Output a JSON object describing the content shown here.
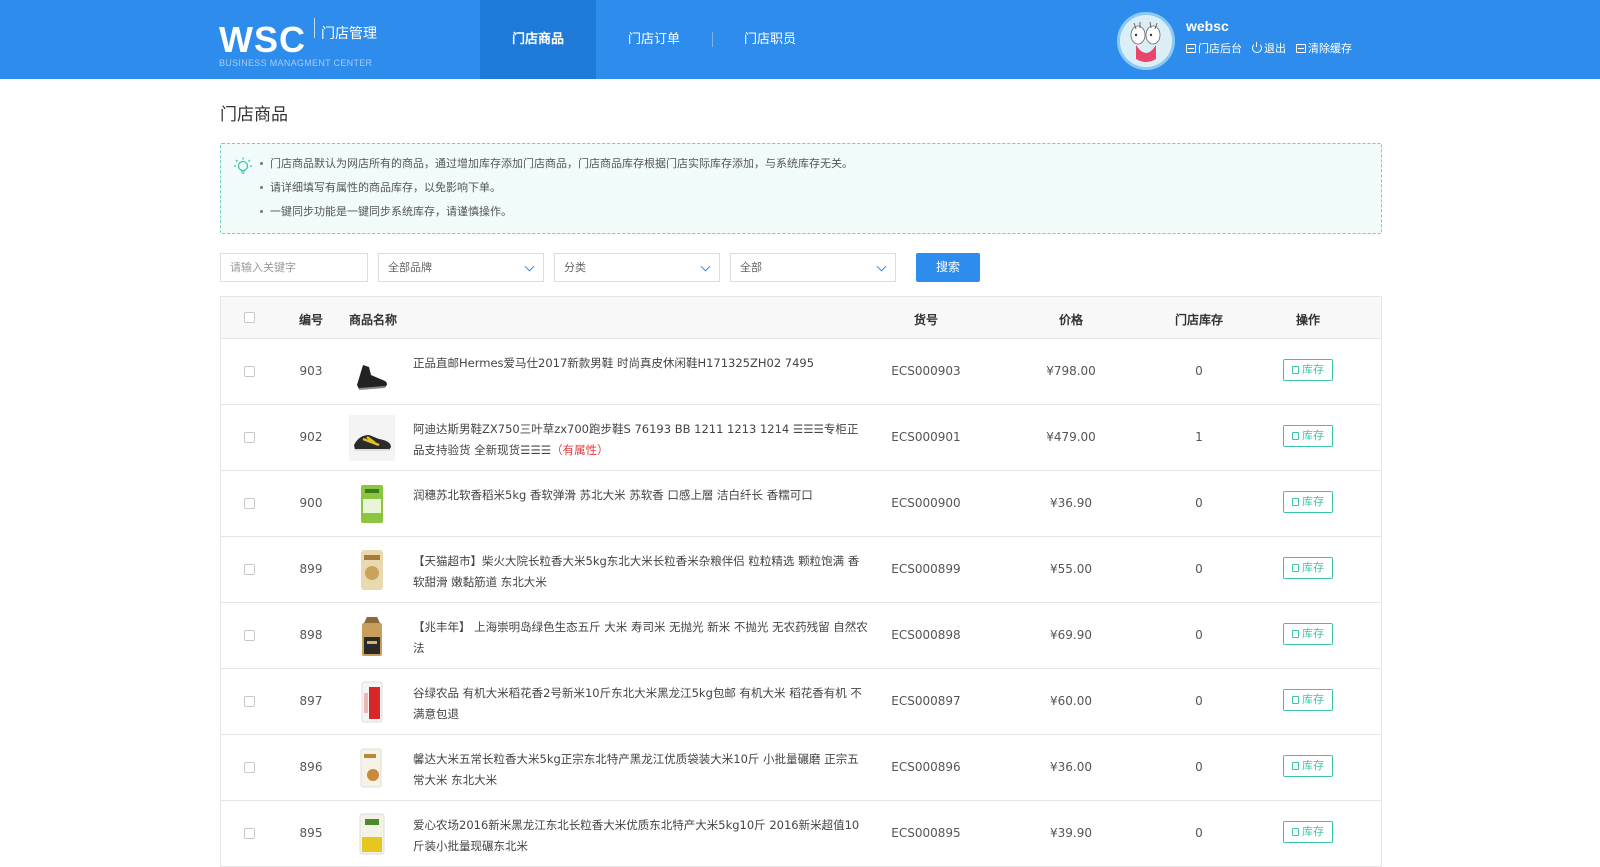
{
  "header": {
    "logo": "WSC",
    "logo_sub": "门店管理",
    "logo_en": "BUSINESS MANAGMENT CENTER",
    "nav": [
      {
        "label": "门店商品",
        "active": true
      },
      {
        "label": "门店订单",
        "active": false
      },
      {
        "label": "门店职员",
        "active": false
      }
    ],
    "user": {
      "name": "websc",
      "links": [
        "门店后台",
        "退出",
        "清除缓存"
      ]
    }
  },
  "page": {
    "title": "门店商品",
    "tips": [
      "门店商品默认为网店所有的商品，通过增加库存添加门店商品，门店商品库存根据门店实际库存添加，与系统库存无关。",
      "请详细填写有属性的商品库存，以免影响下单。",
      "一键同步功能是一键同步系统库存，请谨慎操作。"
    ]
  },
  "filter": {
    "keyword_placeholder": "请输入关键字",
    "brand": "全部品牌",
    "category": "分类",
    "status": "全部",
    "search_label": "搜索"
  },
  "table": {
    "headers": {
      "id": "编号",
      "name": "商品名称",
      "sku": "货号",
      "price": "价格",
      "stock": "门店库存",
      "op": "操作"
    },
    "stock_button": "库存",
    "rows": [
      {
        "id": "903",
        "title": "正品直邮Hermes爱马仕2017新款男鞋 时尚真皮休闲鞋H171325ZH02 7495",
        "attr": "",
        "sku": "ECS000903",
        "price": "¥798.00",
        "stock": "0",
        "thumb": "shoe-black"
      },
      {
        "id": "902",
        "title": "阿迪达斯男鞋ZX750三叶草zx700跑步鞋S 76193 BB 1211 1213 1214 ☰☰☰专柜正品支持验货 全新现货☰☰☰",
        "attr": "（有属性）",
        "sku": "ECS000901",
        "price": "¥479.00",
        "stock": "1",
        "thumb": "shoe-sport"
      },
      {
        "id": "900",
        "title": "润穗苏北软香稻米5kg 香软弹滑 苏北大米 苏软香 口感上層 洁白纤长 香糯可口",
        "attr": "",
        "sku": "ECS000900",
        "price": "¥36.90",
        "stock": "0",
        "thumb": "rice-green"
      },
      {
        "id": "899",
        "title": "【天猫超市】柴火大院长粒香大米5kg东北大米长粒香米杂粮伴侣 粒粒精选 颗粒饱满 香软甜滑 嫩黏筋道 东北大米",
        "attr": "",
        "sku": "ECS000899",
        "price": "¥55.00",
        "stock": "0",
        "thumb": "rice-bag"
      },
      {
        "id": "898",
        "title": "【兆丰年】 上海崇明岛绿色生态五斤 大米 寿司米 无抛光 新米 不抛光 无农药残留 自然农法",
        "attr": "",
        "sku": "ECS000898",
        "price": "¥69.90",
        "stock": "0",
        "thumb": "rice-black"
      },
      {
        "id": "897",
        "title": "谷绿农品 有机大米稻花香2号新米10斤东北大米黑龙江5kg包邮 有机大米 稻花香有机 不满意包退",
        "attr": "",
        "sku": "ECS000897",
        "price": "¥60.00",
        "stock": "0",
        "thumb": "rice-red"
      },
      {
        "id": "896",
        "title": "馨达大米五常长粒香大米5kg正宗东北特产黑龙江优质袋装大米10斤 小批量碾磨 正宗五常大米 东北大米",
        "attr": "",
        "sku": "ECS000896",
        "price": "¥36.00",
        "stock": "0",
        "thumb": "rice-white"
      },
      {
        "id": "895",
        "title": "爱心农场2016新米黑龙江东北长粒香大米优质东北特产大米5kg10斤 2016新米超值10斤装小批量现碾东北米",
        "attr": "",
        "sku": "ECS000895",
        "price": "¥39.90",
        "stock": "0",
        "thumb": "rice-yellow"
      }
    ]
  }
}
